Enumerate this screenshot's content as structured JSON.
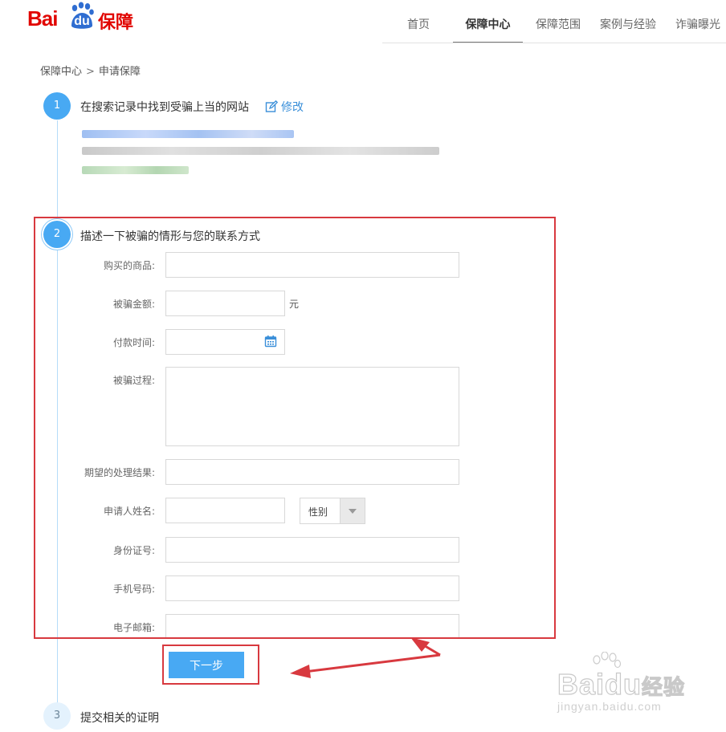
{
  "logo": {
    "bai": "Bai",
    "du": "du",
    "suffix": "保障"
  },
  "nav": {
    "items": [
      "首页",
      "保障中心",
      "保障范围",
      "案例与经验",
      "诈骗曝光"
    ],
    "active": "保障中心"
  },
  "breadcrumb": {
    "parent": "保障中心",
    "separator": ">",
    "current": "申请保障"
  },
  "step1": {
    "number": "1",
    "title": "在搜索记录中找到受骗上当的网站",
    "edit_label": "修改",
    "edit_icon": "edit-icon"
  },
  "step2": {
    "number": "2",
    "title": "描述一下被骗的情形与您的联系方式",
    "fields": {
      "product": {
        "label": "购买的商品:",
        "value": ""
      },
      "amount": {
        "label": "被骗金额:",
        "value": "",
        "unit": "元"
      },
      "pay_time": {
        "label": "付款时间:",
        "value": "",
        "icon": "calendar-icon"
      },
      "process": {
        "label": "被骗过程:",
        "value": ""
      },
      "expected": {
        "label": "期望的处理结果:",
        "value": ""
      },
      "name": {
        "label": "申请人姓名:",
        "value": ""
      },
      "gender": {
        "selected": "性别"
      },
      "id_number": {
        "label": "身份证号:",
        "value": ""
      },
      "phone": {
        "label": "手机号码:",
        "value": ""
      },
      "email": {
        "label": "电子邮箱:",
        "value": ""
      }
    },
    "next_button": "下一步"
  },
  "step3": {
    "number": "3",
    "title": "提交相关的证明"
  },
  "watermark": {
    "brand_a": "Bai",
    "brand_b": "du",
    "brand_c": "经验",
    "url": "jingyan.baidu.com"
  },
  "colors": {
    "brand_red": "#e10601",
    "accent_blue": "#48a9f3",
    "highlight_red": "#d8393f"
  }
}
